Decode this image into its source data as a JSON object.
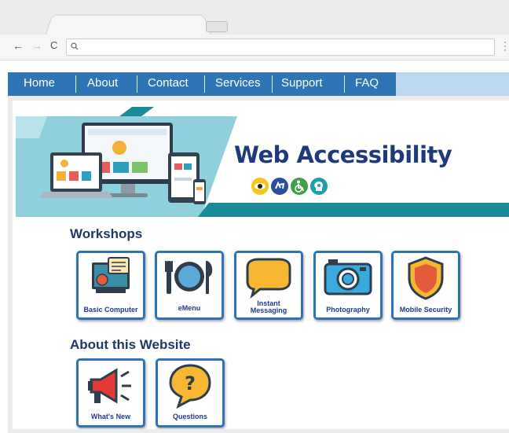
{
  "browser": {
    "back_icon": "←",
    "forward_icon": "→",
    "reload_icon": "C",
    "search_icon": "🔍",
    "menu_icon": "⋮"
  },
  "nav": {
    "items": [
      {
        "label": "Home"
      },
      {
        "label": "About"
      },
      {
        "label": "Contact"
      },
      {
        "label": "Services"
      },
      {
        "label": "Support"
      },
      {
        "label": "FAQ"
      }
    ]
  },
  "banner": {
    "title": "Web Accessibility",
    "icons": [
      "eye-icon",
      "sign-language-icon",
      "wheelchair-icon",
      "cognitive-icon"
    ]
  },
  "workshops": {
    "title": "Workshops",
    "items": [
      {
        "label": "Basic Computer",
        "icon": "computer-icon"
      },
      {
        "label": "eMenu",
        "icon": "plate-utensils-icon"
      },
      {
        "label": "Instant\nMessaging",
        "icon": "chat-bubble-icon"
      },
      {
        "label": "Photography",
        "icon": "camera-icon"
      },
      {
        "label": "Mobile Security",
        "icon": "shield-icon"
      }
    ]
  },
  "about": {
    "title": "About this Website",
    "items": [
      {
        "label": "What's New",
        "icon": "megaphone-icon"
      },
      {
        "label": "Questions",
        "icon": "question-bubble-icon"
      }
    ]
  },
  "colors": {
    "nav_blue": "#2f75b5",
    "nav_light": "#bdd7ee",
    "title_navy": "#1f3a7a",
    "teal": "#1b8a99",
    "tile_border": "#2e74b5"
  }
}
